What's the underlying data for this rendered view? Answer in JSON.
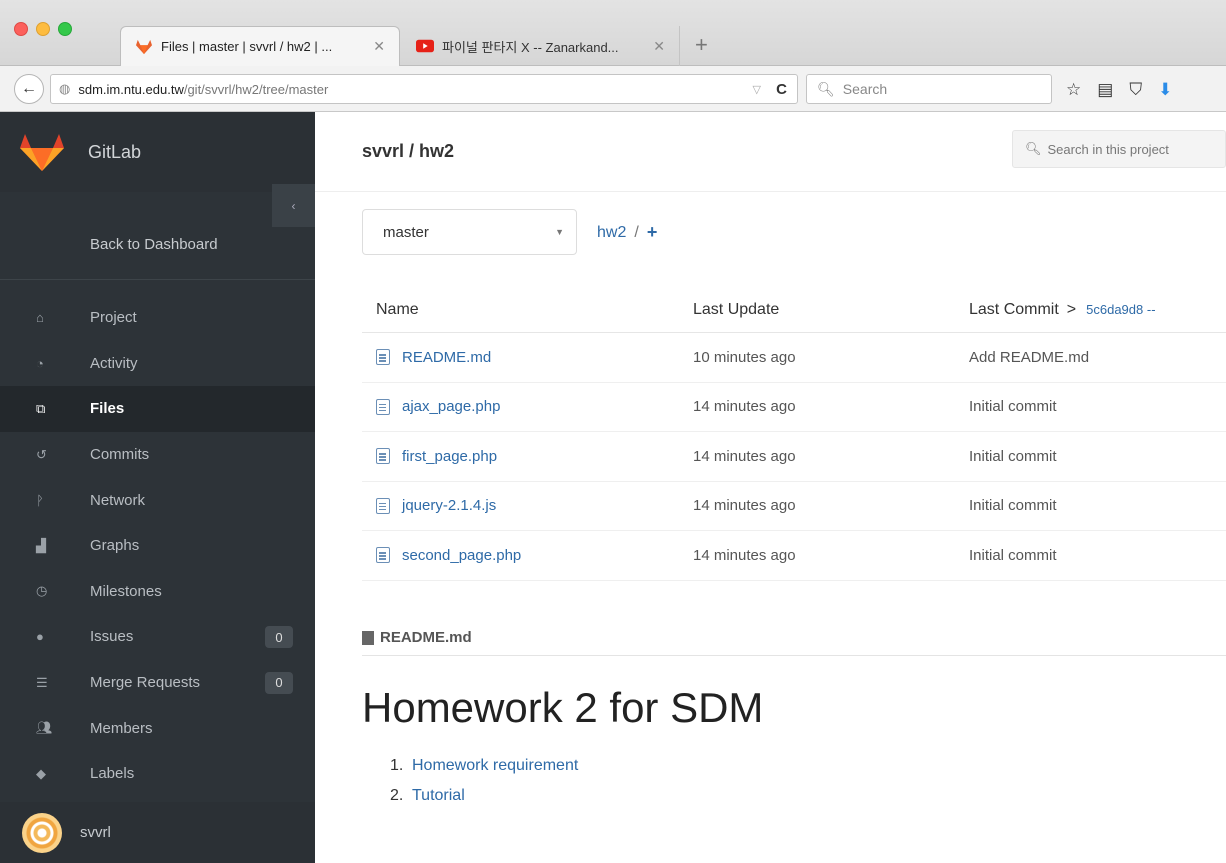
{
  "browser": {
    "tabs": [
      {
        "title": "Files | master | svvrl / hw2 | ...",
        "active": true
      },
      {
        "title": "파이널 판타지 X -- Zanarkand...",
        "active": false
      }
    ],
    "url_host": "sdm.im.ntu.edu.tw",
    "url_path": "/git/svvrl/hw2/tree/master",
    "search_placeholder": "Search"
  },
  "sidebar": {
    "brand": "GitLab",
    "back": "Back to Dashboard",
    "items": [
      {
        "label": "Project",
        "icon": "home-icon"
      },
      {
        "label": "Activity",
        "icon": "dashboard-icon"
      },
      {
        "label": "Files",
        "icon": "files-icon",
        "active": true
      },
      {
        "label": "Commits",
        "icon": "history-icon"
      },
      {
        "label": "Network",
        "icon": "branch-icon"
      },
      {
        "label": "Graphs",
        "icon": "graph-icon"
      },
      {
        "label": "Milestones",
        "icon": "clock-icon"
      },
      {
        "label": "Issues",
        "icon": "exclamation-icon",
        "badge": "0"
      },
      {
        "label": "Merge Requests",
        "icon": "list-icon",
        "badge": "0"
      },
      {
        "label": "Members",
        "icon": "users-icon"
      },
      {
        "label": "Labels",
        "icon": "tag-icon"
      }
    ],
    "user": "svvrl"
  },
  "main": {
    "project_title": "svvrl / hw2",
    "search_placeholder": "Search in this project",
    "branch": "master",
    "breadcrumb": {
      "root": "hw2",
      "sep": "/",
      "add": "+"
    },
    "columns": {
      "name": "Name",
      "last_update": "Last Update",
      "last_commit": "Last Commit",
      "commit_arrow": ">",
      "commit_sha": "5c6da9d8 --"
    },
    "files": [
      {
        "name": "README.md",
        "updated": "10 minutes ago",
        "commit": "Add README.md"
      },
      {
        "name": "ajax_page.php",
        "updated": "14 minutes ago",
        "commit": "Initial commit"
      },
      {
        "name": "first_page.php",
        "updated": "14 minutes ago",
        "commit": "Initial commit"
      },
      {
        "name": "jquery-2.1.4.js",
        "updated": "14 minutes ago",
        "commit": "Initial commit"
      },
      {
        "name": "second_page.php",
        "updated": "14 minutes ago",
        "commit": "Initial commit"
      }
    ],
    "readme": {
      "filename": "README.md",
      "title": "Homework 2 for SDM",
      "list": [
        {
          "num": "1.",
          "text": "Homework requirement"
        },
        {
          "num": "2.",
          "text": "Tutorial"
        }
      ]
    }
  }
}
